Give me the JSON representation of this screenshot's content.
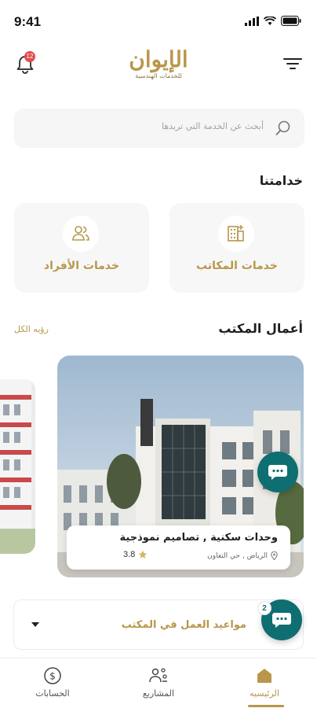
{
  "status_bar": {
    "time": "9:41"
  },
  "header": {
    "logo_title": "الإيوان",
    "logo_subtitle": "للخدمات الهندسية",
    "notification_count": "12"
  },
  "search": {
    "placeholder": "أبحث عن الخدمة التي تريدها"
  },
  "services": {
    "title": "خدامتنا",
    "items": [
      {
        "label": "خدمات المكاتب",
        "icon": "building-icon"
      },
      {
        "label": "خدمات الأفراد",
        "icon": "users-icon"
      }
    ]
  },
  "works": {
    "title": "أعمال المكتب",
    "see_all": "رؤيه الكل",
    "card": {
      "title": "وحدات سكنية , تصاميم نموذجية",
      "location": "الرياض , حي التعاون",
      "rating": "3.8"
    }
  },
  "office_hours": {
    "label": "مواعيد العمل في المكتب"
  },
  "chat": {
    "badge": "2"
  },
  "tabs": [
    {
      "label": "الرئيسيه",
      "icon": "home-icon",
      "active": true
    },
    {
      "label": "المشاريع",
      "icon": "projects-icon",
      "active": false
    },
    {
      "label": "الحسابات",
      "icon": "dollar-icon",
      "active": false
    }
  ],
  "colors": {
    "accent": "#b8974b",
    "teal": "#0f6e72",
    "badge": "#e14d4d"
  }
}
